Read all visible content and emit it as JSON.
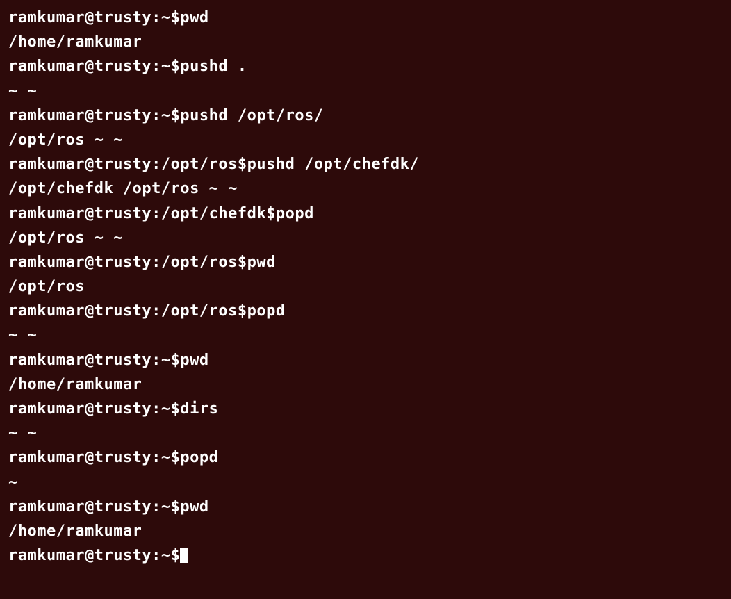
{
  "terminal": {
    "lines": [
      {
        "type": "prompt",
        "prefix": "ramkumar@trusty:~$",
        "cmd": "pwd"
      },
      {
        "type": "output",
        "text": "/home/ramkumar"
      },
      {
        "type": "prompt",
        "prefix": "ramkumar@trusty:~$",
        "cmd": "pushd ."
      },
      {
        "type": "output",
        "text": "~ ~"
      },
      {
        "type": "prompt",
        "prefix": "ramkumar@trusty:~$",
        "cmd": "pushd /opt/ros/"
      },
      {
        "type": "output",
        "text": "/opt/ros ~ ~"
      },
      {
        "type": "prompt",
        "prefix": "ramkumar@trusty:/opt/ros$",
        "cmd": "pushd /opt/chefdk/"
      },
      {
        "type": "output",
        "text": "/opt/chefdk /opt/ros ~ ~"
      },
      {
        "type": "prompt",
        "prefix": "ramkumar@trusty:/opt/chefdk$",
        "cmd": "popd"
      },
      {
        "type": "output",
        "text": "/opt/ros ~ ~"
      },
      {
        "type": "prompt",
        "prefix": "ramkumar@trusty:/opt/ros$",
        "cmd": "pwd"
      },
      {
        "type": "output",
        "text": "/opt/ros"
      },
      {
        "type": "prompt",
        "prefix": "ramkumar@trusty:/opt/ros$",
        "cmd": "popd"
      },
      {
        "type": "output",
        "text": "~ ~"
      },
      {
        "type": "prompt",
        "prefix": "ramkumar@trusty:~$",
        "cmd": "pwd"
      },
      {
        "type": "output",
        "text": "/home/ramkumar"
      },
      {
        "type": "prompt",
        "prefix": "ramkumar@trusty:~$",
        "cmd": "dirs"
      },
      {
        "type": "output",
        "text": "~ ~"
      },
      {
        "type": "prompt",
        "prefix": "ramkumar@trusty:~$",
        "cmd": "popd"
      },
      {
        "type": "output",
        "text": "~"
      },
      {
        "type": "prompt",
        "prefix": "ramkumar@trusty:~$",
        "cmd": "pwd"
      },
      {
        "type": "output",
        "text": "/home/ramkumar"
      },
      {
        "type": "prompt-cursor",
        "prefix": "ramkumar@trusty:~$",
        "cmd": ""
      }
    ]
  }
}
